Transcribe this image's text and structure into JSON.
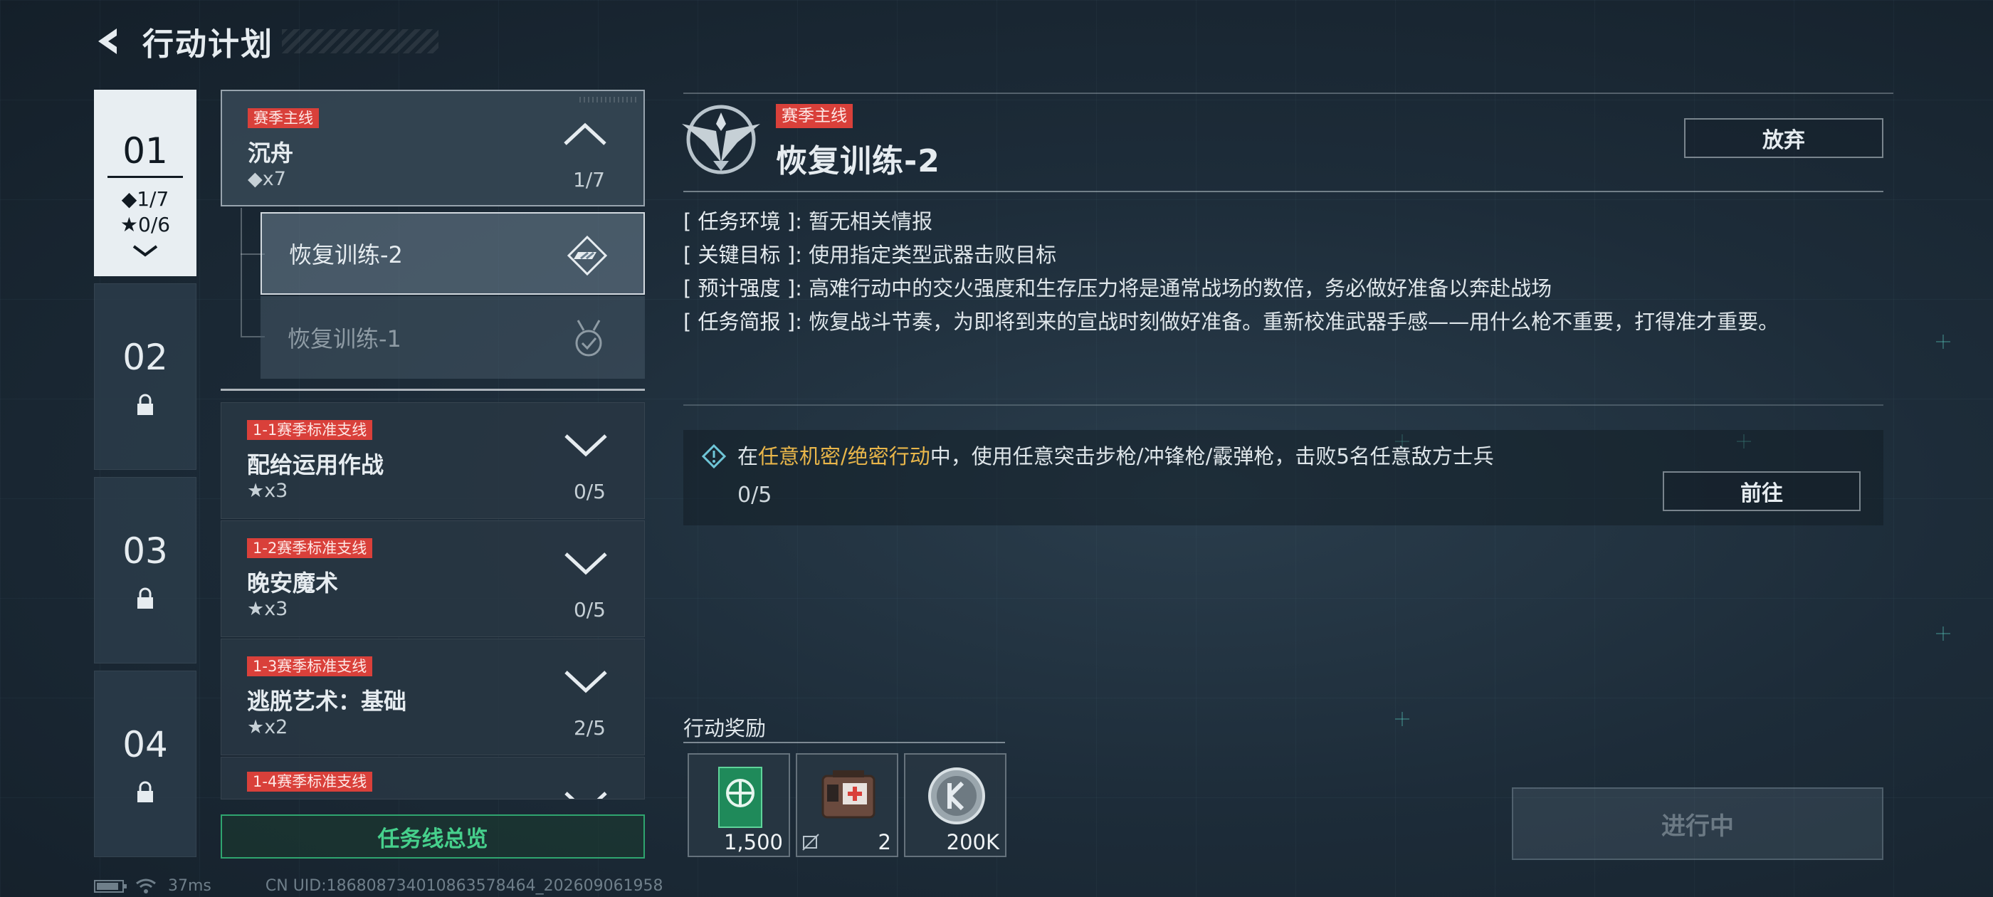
{
  "header": {
    "title": "行动计划"
  },
  "chapters": [
    {
      "num": "01",
      "diamonds": "◆1/7",
      "stars": "★0/6"
    },
    {
      "num": "02"
    },
    {
      "num": "03"
    },
    {
      "num": "04"
    }
  ],
  "missions": [
    {
      "tag": "赛季主线",
      "name": "沉舟",
      "req": "◆x7",
      "progress": "1/7",
      "subs": [
        {
          "label": "恢复训练-2"
        },
        {
          "label": "恢复训练-1"
        }
      ]
    },
    {
      "tag": "1-1赛季标准支线",
      "name": "配给运用作战",
      "req": "★x3",
      "progress": "0/5"
    },
    {
      "tag": "1-2赛季标准支线",
      "name": "晚安魔术",
      "req": "★x3",
      "progress": "0/5"
    },
    {
      "tag": "1-3赛季标准支线",
      "name": "逃脱艺术：基础",
      "req": "★x2",
      "progress": "2/5"
    },
    {
      "tag": "1-4赛季标准支线"
    }
  ],
  "overview_button": "任务线总览",
  "detail": {
    "tag": "赛季主线",
    "title": "恢复训练-2",
    "abandon": "放弃",
    "info": [
      {
        "label": "[ 任务环境 ]:",
        "text": "暂无相关情报"
      },
      {
        "label": "[ 关键目标 ]:",
        "text": "使用指定类型武器击败目标"
      },
      {
        "label": "[ 预计强度 ]:",
        "text": "高难行动中的交火强度和生存压力将是通常战场的数倍，务必做好准备以奔赴战场"
      },
      {
        "label": "[ 任务简报 ]:",
        "text": "恢复战斗节奏，为即将到来的宣战时刻做好准备。重新校准武器手感——用什么枪不重要，打得准才重要。"
      }
    ],
    "objective": {
      "prefix": "在",
      "highlight": "任意机密/绝密行动",
      "suffix": "中，使用任意突击步枪/冲锋枪/霰弹枪，击败5名任意敌方士兵",
      "progress": "0/5",
      "goto": "前往"
    },
    "rewards_title": "行动奖励",
    "rewards": [
      {
        "icon": "green-box-icon",
        "count": "1,500"
      },
      {
        "icon": "medkit-icon",
        "count": "2"
      },
      {
        "icon": "silver-coin-icon",
        "count": "200K"
      }
    ],
    "status_button": "进行中"
  },
  "status_bar": {
    "ping": "37ms",
    "uid": "CN UID:18680873401086357846​4_202609061958"
  },
  "colors": {
    "red_tag": "#d9403a",
    "green": "#46d08c",
    "gold": "#e9b64a"
  }
}
